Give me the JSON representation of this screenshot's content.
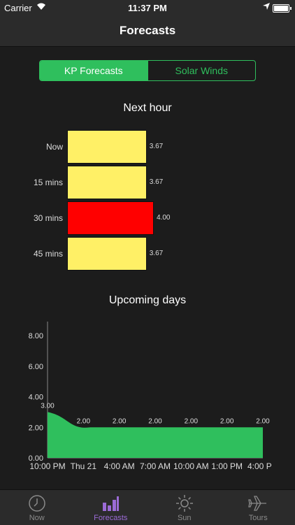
{
  "status": {
    "carrier": "Carrier",
    "time": "11:37 PM"
  },
  "nav": {
    "title": "Forecasts"
  },
  "segment": {
    "active": "KP Forecasts",
    "inactive": "Solar Winds"
  },
  "next_hour": {
    "title": "Next hour",
    "colors": {
      "normal": "#fff066",
      "alert": "#ff0000"
    },
    "rows": [
      {
        "label": "Now",
        "value": "3.67"
      },
      {
        "label": "15 mins",
        "value": "3.67"
      },
      {
        "label": "30 mins",
        "value": "4.00"
      },
      {
        "label": "45 mins",
        "value": "3.67"
      }
    ]
  },
  "upcoming": {
    "title": "Upcoming days"
  },
  "chart_data": [
    {
      "type": "bar",
      "orientation": "horizontal",
      "title": "Next hour",
      "categories": [
        "Now",
        "15 mins",
        "30 mins",
        "45 mins"
      ],
      "values": [
        3.67,
        3.67,
        4.0,
        3.67
      ],
      "colors": [
        "#fff066",
        "#fff066",
        "#ff0000",
        "#fff066"
      ]
    },
    {
      "type": "area",
      "title": "Upcoming days",
      "color": "#2fbf5d",
      "ylim": [
        0,
        8
      ],
      "y_ticks": [
        "0.00",
        "2.00",
        "4.00",
        "6.00",
        "8.00"
      ],
      "x_ticks": [
        "10:00 PM",
        "Thu 21",
        "4:00 AM",
        "7:00 AM",
        "10:00 AM",
        "1:00 PM",
        "4:00 P"
      ],
      "points": [
        {
          "label": "3.00",
          "value": 3.0
        },
        {
          "label": "2.00",
          "value": 2.0
        },
        {
          "label": "2.00",
          "value": 2.0
        },
        {
          "label": "2.00",
          "value": 2.0
        },
        {
          "label": "2.00",
          "value": 2.0
        },
        {
          "label": "2.00",
          "value": 2.0
        },
        {
          "label": "2.00",
          "value": 2.0
        }
      ]
    }
  ],
  "tabs": [
    {
      "label": "Now",
      "icon": "clock-icon"
    },
    {
      "label": "Forecasts",
      "icon": "bar-chart-icon"
    },
    {
      "label": "Sun",
      "icon": "sun-icon"
    },
    {
      "label": "Tours",
      "icon": "airplane-icon"
    }
  ]
}
